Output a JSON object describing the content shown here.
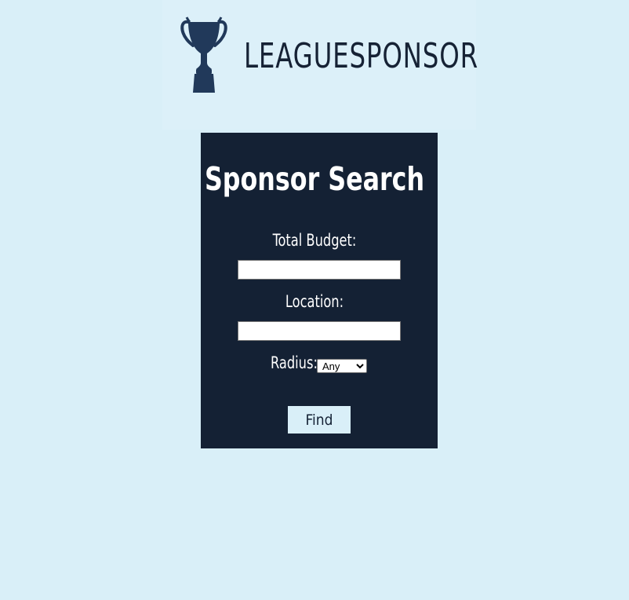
{
  "brand": {
    "name": "LEAGUESPONSOR",
    "logo_icon": "trophy-icon",
    "logo_color": "#21395a"
  },
  "search": {
    "title": "Sponsor Search",
    "budget_label": "Total Budget:",
    "budget_value": "",
    "location_label": "Location:",
    "location_value": "",
    "radius_label": "Radius:",
    "radius_options": [
      "Any"
    ],
    "radius_selected": "Any",
    "submit_label": "Find"
  },
  "colors": {
    "page_background": "#d9eff8",
    "panel_background": "#142134",
    "text_on_panel": "#ffffff"
  }
}
